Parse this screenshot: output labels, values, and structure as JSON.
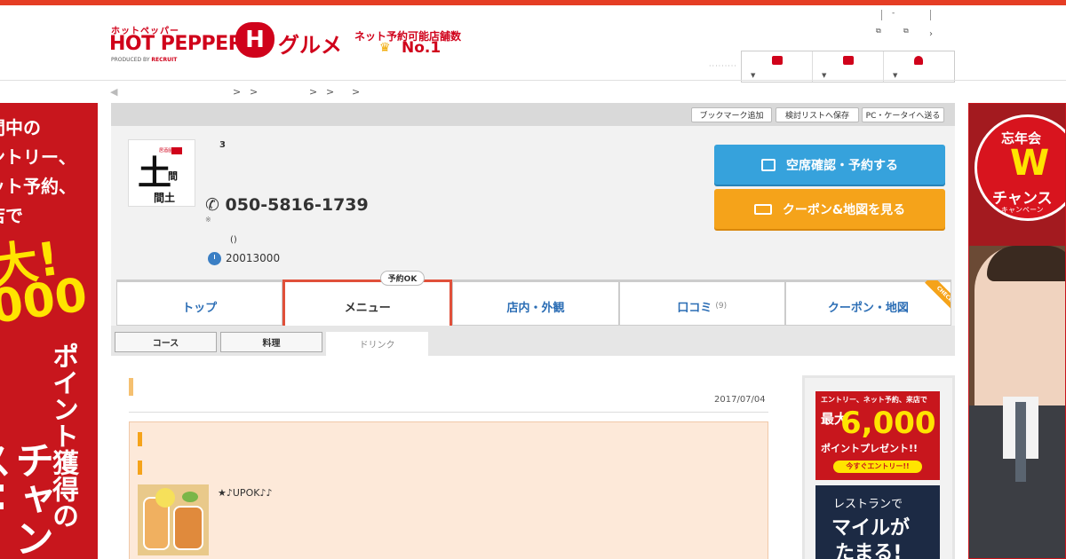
{
  "header": {
    "logo_kana": "ホットペッパー",
    "logo_main": "HOT PEPPER",
    "logo_h": "H",
    "logo_gurume": "グルメ",
    "produced_by": "PRODUCED BY",
    "recruit": "RECRUIT",
    "tagline": "ネット予約可能店舗数",
    "no1": "No.1",
    "mini_dash": "-",
    "mini_arrow": "›",
    "brand_color": "#d0021b"
  },
  "panel_buttons": {
    "bookmark": "ブックマーク追加",
    "save_list": "検討リストへ保存",
    "send_pc": "PC・ケータイへ送る"
  },
  "shop": {
    "logo_kanji_top": "土",
    "logo_kanji_mid": "間",
    "logo_kanji_bottom": "間土",
    "logo_label": "居酒屋",
    "number": "3",
    "tel": "050-5816-1739",
    "tel_note": "※",
    "paren": "()",
    "clock_number": "20013000"
  },
  "actions": {
    "reserve": "空席確認・予約する",
    "coupon": "クーポン&地図を見る"
  },
  "tabs": [
    {
      "label": "トップ"
    },
    {
      "label": "メニュー",
      "badge": "予約OK"
    },
    {
      "label": "店内・外観"
    },
    {
      "label": "口コミ",
      "count": "(9)"
    },
    {
      "label": "クーポン・地図",
      "ribbon": "CHECK"
    }
  ],
  "subtabs": [
    {
      "label": "コース"
    },
    {
      "label": "料理"
    },
    {
      "label": "ドリンク"
    }
  ],
  "content": {
    "date": "2017/07/04",
    "menu_name": "★♪UPOK♪♪"
  },
  "ad_left": {
    "line1": "間中の",
    "line2": "ントリー、",
    "line3": "ット予約、",
    "line4": "店で",
    "big1": "大!",
    "big2": ",000",
    "vertical1": "ポイント獲得の",
    "vertical2": "チャンス!!"
  },
  "ad_right": {
    "text1": "忘年会",
    "text_w": "W",
    "text2": "チャンス",
    "text3": "キャンペーン"
  },
  "side_ad1": {
    "line1": "エントリー、ネット予約、来店で",
    "line2": "最大",
    "amount": "6,000",
    "line3": "ポイントプレゼント!!",
    "cta": "今すぐエントリー!!"
  },
  "side_ad2": {
    "line1": "レストランで",
    "line2": "マイルが",
    "line3": "たまる!"
  }
}
